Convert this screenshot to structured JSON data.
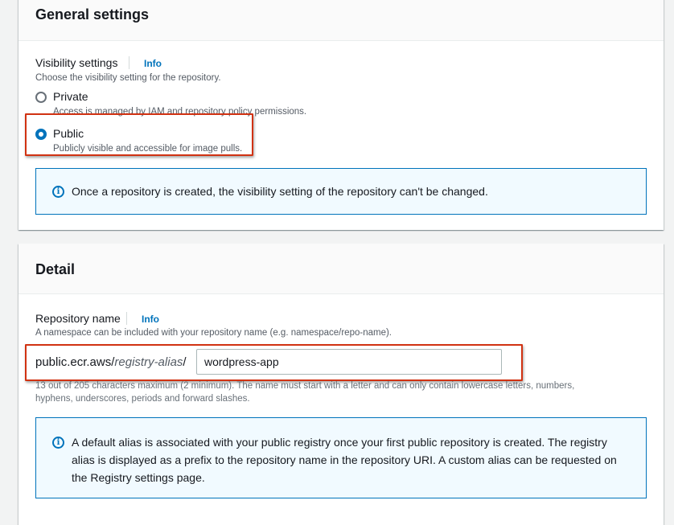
{
  "general_settings": {
    "title": "General settings",
    "visibility_label": "Visibility settings",
    "info_label": "Info",
    "visibility_description": "Choose the visibility setting for the repository.",
    "options": [
      {
        "label": "Private",
        "description": "Access is managed by IAM and repository policy permissions.",
        "selected": false
      },
      {
        "label": "Public",
        "description": "Publicly visible and accessible for image pulls.",
        "selected": true
      }
    ],
    "alert_text": "Once a repository is created, the visibility setting of the repository can't be changed."
  },
  "detail": {
    "title": "Detail",
    "repo_name_label": "Repository name",
    "info_label": "Info",
    "repo_name_description": "A namespace can be included with your repository name (e.g. namespace/repo-name).",
    "prefix_host": "public.ecr.aws/",
    "prefix_alias": "registry-alias",
    "prefix_slash": "/",
    "repo_name_value": "wordpress-app",
    "constraint_line1": "13 out of 205 characters maximum (2 minimum). The name must start with a letter and can only contain lowercase letters, numbers,",
    "constraint_line2": "hyphens, underscores, periods and forward slashes.",
    "alert_line1": "A default alias is associated with your public registry once your first public repository is created. The registry",
    "alert_line2": "alias is displayed as a prefix to the repository name in the repository URI. A custom alias can be requested on",
    "alert_line3": "the Registry settings page."
  },
  "colors": {
    "accent": "#0073bb",
    "highlight": "#d13212",
    "alert_bg": "#f1faff"
  }
}
